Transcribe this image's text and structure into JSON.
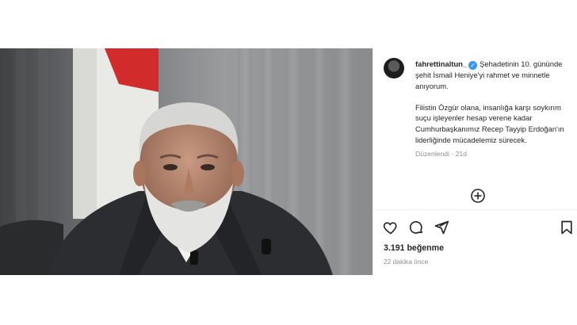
{
  "post": {
    "username": "fahrettinaltun_",
    "verified_icon": "verified-badge-icon",
    "caption_line1": "Şehadetinin 10. gününde şehit İsmail Heniye'yi rahmet ve minnetle anıyorum.",
    "caption_line2": "Filistin Özgür olana, insanlığa karşı soykırım suçu işleyenler hesap verene kadar Cumhurbaşkanımız Recep Tayyip Erdoğan'ın liderliğinde mücadelemiz sürecek.",
    "edited_label": "Düzenlendi",
    "edited_age": "21d",
    "likes": "3.191 beğenme",
    "timestamp": "22 dakika önce"
  },
  "icons": {
    "add": "add-circle-icon",
    "like": "heart-icon",
    "comment": "comment-icon",
    "share": "send-icon",
    "save": "bookmark-icon"
  },
  "colors": {
    "verified": "#3897f0",
    "text": "#262626",
    "muted": "#8e8e8e"
  }
}
